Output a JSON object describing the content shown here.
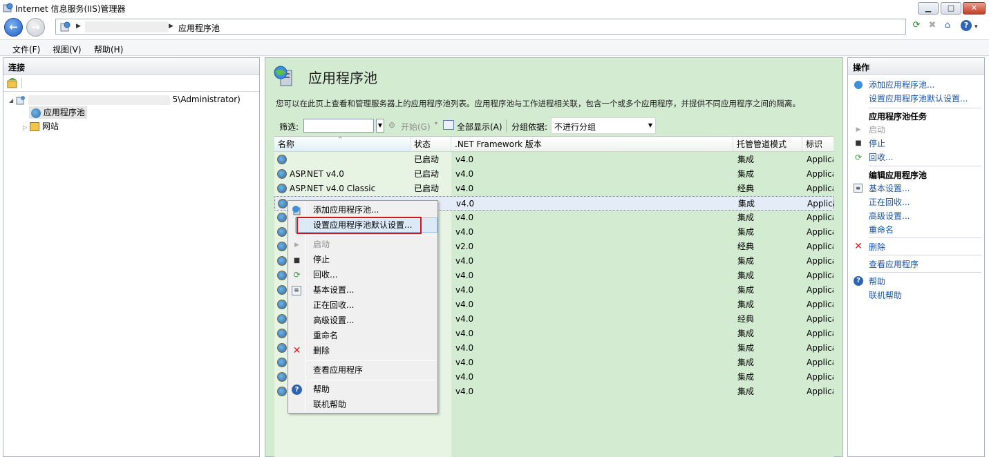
{
  "window": {
    "title": "Internet 信息服务(IIS)管理器",
    "controls": {
      "minimize": "▁",
      "maximize": "□",
      "close": "✕"
    }
  },
  "address": {
    "crumb": "应用程序池"
  },
  "menu": {
    "file": "文件(F)",
    "view": "视图(V)",
    "help": "帮助(H)"
  },
  "connections": {
    "title": "连接",
    "server_label": "5\\Administrator)",
    "app_pools": "应用程序池",
    "sites": "网站"
  },
  "main": {
    "title": "应用程序池",
    "description": "您可以在此页上查看和管理服务器上的应用程序池列表。应用程序池与工作进程相关联，包含一个或多个应用程序，并提供不同应用程序之间的隔离。",
    "filter": {
      "label": "筛选:",
      "start": "开始(G)",
      "show_all": "全部显示(A)",
      "group_by_label": "分组依据:",
      "group_by_value": "不进行分组"
    },
    "columns": {
      "name": "名称",
      "state": "状态",
      "framework": ".NET Framework 版本",
      "pipeline": "托管管道模式",
      "identity": "标识"
    },
    "rows": [
      {
        "name": "",
        "state": "已启动",
        "framework": "v4.0",
        "pipeline": "集成",
        "identity": "Applica"
      },
      {
        "name": "ASP.NET v4.0",
        "state": "已启动",
        "framework": "v4.0",
        "pipeline": "集成",
        "identity": "Applica"
      },
      {
        "name": "ASP.NET v4.0 Classic",
        "state": "已启动",
        "framework": "v4.0",
        "pipeline": "经典",
        "identity": "Applica"
      },
      {
        "name": "",
        "state": "",
        "framework": "v4.0",
        "pipeline": "集成",
        "identity": "Applica"
      },
      {
        "name": "",
        "state": "",
        "framework": "v4.0",
        "pipeline": "集成",
        "identity": "Applica"
      },
      {
        "name": "",
        "state": "",
        "framework": "v4.0",
        "pipeline": "集成",
        "identity": "Applica"
      },
      {
        "name": "",
        "state": "",
        "framework": "v2.0",
        "pipeline": "经典",
        "identity": "Applica"
      },
      {
        "name": "",
        "state": "",
        "framework": "v4.0",
        "pipeline": "集成",
        "identity": "Applica"
      },
      {
        "name": "",
        "state": "",
        "framework": "v4.0",
        "pipeline": "集成",
        "identity": "Applica"
      },
      {
        "name": "",
        "state": "",
        "framework": "v4.0",
        "pipeline": "集成",
        "identity": "Applica"
      },
      {
        "name": "",
        "state": "",
        "framework": "v4.0",
        "pipeline": "集成",
        "identity": "Applica"
      },
      {
        "name": "",
        "state": "",
        "framework": "v4.0",
        "pipeline": "经典",
        "identity": "Applica"
      },
      {
        "name": "",
        "state": "",
        "framework": "v4.0",
        "pipeline": "集成",
        "identity": "Applica"
      },
      {
        "name": "",
        "state": "",
        "framework": "v4.0",
        "pipeline": "集成",
        "identity": "Applica"
      },
      {
        "name": "",
        "state": "",
        "framework": "v4.0",
        "pipeline": "集成",
        "identity": "Applica"
      },
      {
        "name": "",
        "state": "",
        "framework": "v4.0",
        "pipeline": "集成",
        "identity": "Applica"
      },
      {
        "name": "",
        "state": "",
        "framework": "v4.0",
        "pipeline": "集成",
        "identity": "Applica"
      }
    ]
  },
  "actions": {
    "title": "操作",
    "add_pool": "添加应用程序池...",
    "set_defaults": "设置应用程序池默认设置...",
    "tasks_header": "应用程序池任务",
    "start": "启动",
    "stop": "停止",
    "recycle": "回收...",
    "edit_header": "编辑应用程序池",
    "basic": "基本设置...",
    "recycling": "正在回收...",
    "advanced": "高级设置...",
    "rename": "重命名",
    "delete": "删除",
    "view_apps": "查看应用程序",
    "help": "帮助",
    "online_help": "联机帮助"
  },
  "context_menu": {
    "add_pool": "添加应用程序池...",
    "set_defaults": "设置应用程序池默认设置...",
    "start": "启动",
    "stop": "停止",
    "recycle": "回收...",
    "basic": "基本设置...",
    "recycling": "正在回收...",
    "advanced": "高级设置...",
    "rename": "重命名",
    "delete": "删除",
    "view_apps": "查看应用程序",
    "help": "帮助",
    "online_help": "联机帮助"
  },
  "colors": {
    "accent_link": "#1a55a8",
    "center_bg": "#d2ebd1",
    "highlight_box": "#d0141a"
  }
}
